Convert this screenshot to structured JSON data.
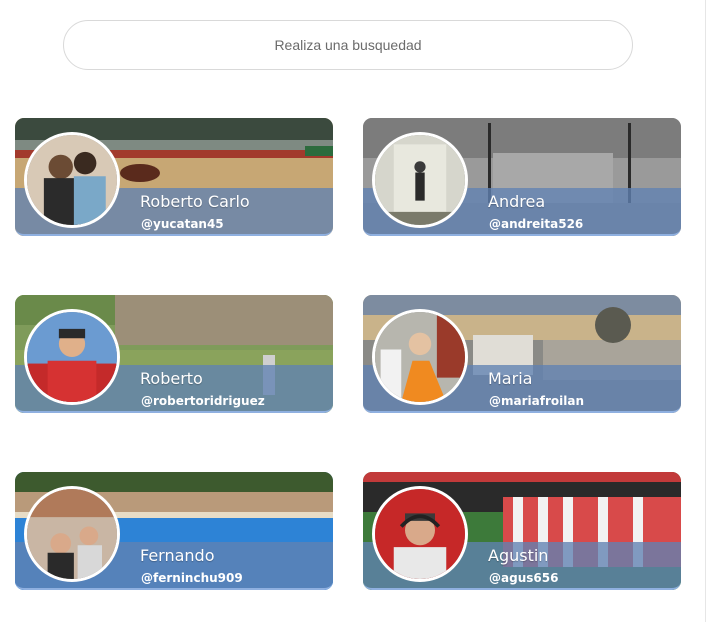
{
  "search": {
    "placeholder": "Realiza una busquedad"
  },
  "users": [
    {
      "name": "Roberto Carlo",
      "handle": "@yucatan45"
    },
    {
      "name": "Andrea",
      "handle": "@andreita526"
    },
    {
      "name": "Roberto",
      "handle": "@robertoridriguez"
    },
    {
      "name": "Maria",
      "handle": "@mariafroilan"
    },
    {
      "name": "Fernando",
      "handle": "@ferninchu909"
    },
    {
      "name": "Agustin",
      "handle": "@agus656"
    }
  ]
}
